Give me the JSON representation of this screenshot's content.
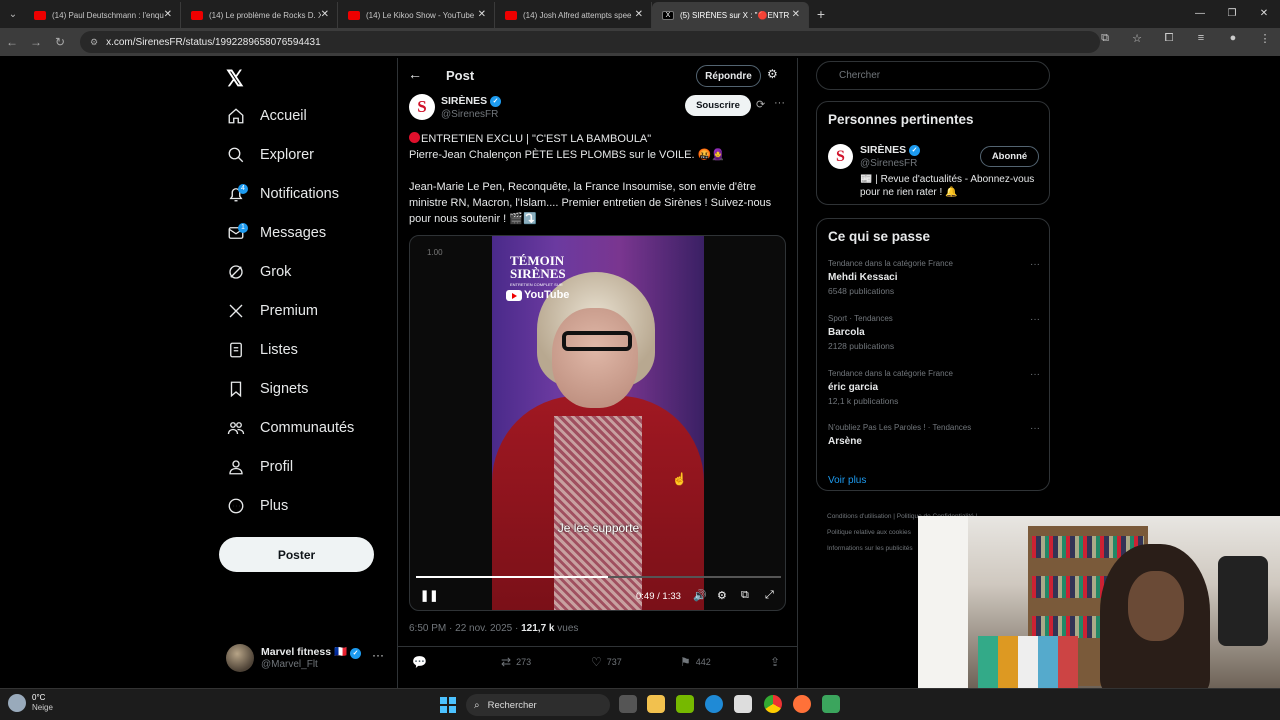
{
  "browser": {
    "tabs": [
      {
        "title": "(14) Paul Deutschmann : l'enquête",
        "fav": "youtube"
      },
      {
        "title": "(14) Le problème de Rocks D. X",
        "fav": "youtube"
      },
      {
        "title": "(14) Le Kikoo Show - YouTube",
        "fav": "youtube"
      },
      {
        "title": "(14) Josh Alfred attempts spee",
        "fav": "youtube"
      },
      {
        "title": "(5) SIRÈNES sur X : \"🔴ENTR",
        "fav": "x",
        "active": true
      }
    ],
    "url": "x.com/SirenesFR/status/1992289658076594431"
  },
  "nav": {
    "logo": "𝕏",
    "items": [
      {
        "label": "Accueil",
        "icon": "home-icon"
      },
      {
        "label": "Explorer",
        "icon": "search-icon"
      },
      {
        "label": "Notifications",
        "icon": "bell-icon",
        "badge": "4"
      },
      {
        "label": "Messages",
        "icon": "mail-icon",
        "badge": "1"
      },
      {
        "label": "Grok",
        "icon": "grok-icon"
      },
      {
        "label": "Premium",
        "icon": "x-logo-icon"
      },
      {
        "label": "Listes",
        "icon": "list-icon"
      },
      {
        "label": "Signets",
        "icon": "bookmark-icon"
      },
      {
        "label": "Communautés",
        "icon": "community-icon"
      },
      {
        "label": "Profil",
        "icon": "user-icon"
      },
      {
        "label": "Plus",
        "icon": "more-circle-icon"
      }
    ],
    "post_button": "Poster",
    "account": {
      "name": "Marvel fitness 🇫🇷",
      "handle": "@Marvel_Flt"
    }
  },
  "post": {
    "header_title": "Post",
    "reply_button": "Répondre",
    "author": {
      "name": "SIRÈNES",
      "handle": "@SirenesFR",
      "avatar_letter": "S"
    },
    "subscribe_button": "Souscrire",
    "text_line1": "ENTRETIEN EXCLU | \"C'EST LA BAMBOULA\"",
    "text_line2": "Pierre-Jean Chalençon PÈTE LES PLOMBS sur le VOILE. 🤬🧕",
    "text_para2": "Jean-Marie Le Pen, Reconquête, la France Insoumise, son envie d'être ministre RN, Macron, l'Islam....  Premier entretien de Sirènes ! Suivez-nous pour nous soutenir ! 🎬⤵️",
    "video": {
      "speed": "1.00",
      "brand_line1": "TÉMOIN",
      "brand_line2": "SIRÈNES",
      "brand_sub": "ENTRETIEN COMPLET SUR",
      "brand_yt": "YouTube",
      "subtitle": "Je les supporte",
      "time": "0:49 / 1:33",
      "progress": 0.527
    },
    "timestamp": "6:50 PM · 22 nov. 2025 · ",
    "views": "121,7 k",
    "views_label": " vues",
    "actions": {
      "reposts": "273",
      "likes": "737",
      "bookmarks": "442"
    }
  },
  "sidebar": {
    "search_placeholder": "Chercher",
    "relevant": {
      "title": "Personnes pertinentes",
      "name": "SIRÈNES",
      "handle": "@SirenesFR",
      "follow_button": "Abonné",
      "bio": "📰 | Revue d'actualités - Abonnez-vous pour ne rien rater ! 🔔"
    },
    "trends": {
      "title": "Ce qui se passe",
      "items": [
        {
          "category": "Tendance dans la catégorie France",
          "name": "Mehdi Kessaci",
          "count": "6548 publications"
        },
        {
          "category": "Sport · Tendances",
          "name": "Barcola",
          "count": "2128 publications"
        },
        {
          "category": "Tendance dans la catégorie France",
          "name": "éric garcia",
          "count": "12,1 k publications"
        },
        {
          "category": "N'oubliez Pas Les Paroles ! · Tendances",
          "name": "Arsène",
          "count": ""
        }
      ],
      "show_more": "Voir plus"
    },
    "footer": {
      "line1": "Conditions d'utilisation  |  Politique de Confidentialité  |",
      "line2": "Politique relative aux cookies",
      "line3": "Informations sur les publicités"
    }
  },
  "taskbar": {
    "temp": "0°C",
    "weather": "Neige",
    "search": "Rechercher"
  }
}
